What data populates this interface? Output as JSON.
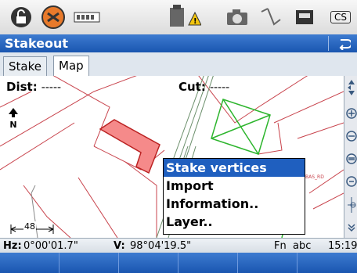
{
  "statusbar": {
    "icons": [
      "lock-icon",
      "gps-satellite-icon",
      "battery-icon",
      "instrument-warning-icon",
      "camera-icon",
      "measure-icon",
      "memory-card-icon",
      "cs-badge-icon"
    ],
    "cs_label": "CS"
  },
  "titlebar": {
    "title": "Stakeout"
  },
  "tabs": [
    {
      "label": "Stake"
    },
    {
      "label": "Map"
    }
  ],
  "active_tab": "Map",
  "map": {
    "dist_label": "Dist:",
    "dist_value": "-----",
    "cut_label": "Cut:",
    "cut_value": "-----",
    "north_label": "N",
    "scale_label": "48",
    "point_label": "BAS_RD"
  },
  "context_menu": {
    "items": [
      {
        "label": "Stake vertices",
        "selected": true
      },
      {
        "label": "Import",
        "selected": false
      },
      {
        "label": "Information..",
        "selected": false
      },
      {
        "label": "Layer..",
        "selected": false
      }
    ]
  },
  "readout": {
    "hz_label": "Hz:",
    "hz_value": "0°00'01.7\"",
    "v_label": "V:",
    "v_value": "98°04'19.5\"",
    "fn_label": "Fn",
    "input_mode": "abc",
    "time": "15:19"
  },
  "colors": {
    "title_bg": "#1a56b0",
    "selected_bg": "#1f5fbf",
    "parcel_fill": "#f58a8a"
  }
}
